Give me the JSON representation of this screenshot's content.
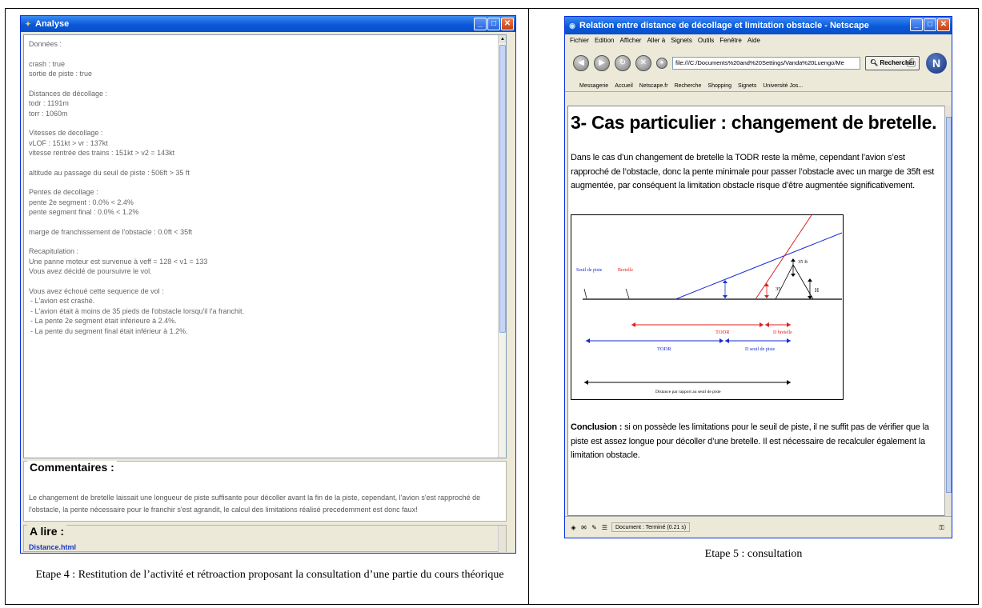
{
  "left_window": {
    "title": "Analyse",
    "body_lines": [
      {
        "text": "Données :",
        "gap_after": true
      },
      {
        "text": "crash : true"
      },
      {
        "text": "sortie de piste : true",
        "gap_after": true
      },
      {
        "text": "Distances de décollage :"
      },
      {
        "text": "todr : 1191m"
      },
      {
        "text": "torr : 1060m",
        "gap_after": true
      },
      {
        "text": "Vitesses de decollage :"
      },
      {
        "text": "vLOF : 151kt > vr : 137kt"
      },
      {
        "text": "vitesse rentrée des trains : 151kt > v2 = 143kt",
        "gap_after": true
      },
      {
        "text": "altitude au passage du seuil de piste : 506ft > 35 ft",
        "gap_after": true
      },
      {
        "text": "Pentes de decollage :"
      },
      {
        "text": "pente 2e segment : 0.0% < 2.4%"
      },
      {
        "text": "pente segment final : 0.0% < 1.2%",
        "gap_after": true
      },
      {
        "text": "marge de franchissement de l'obstacle : 0.0ft < 35ft",
        "gap_after": true
      },
      {
        "text": "Recapitulation :"
      },
      {
        "text": "Une panne moteur est survenue à veff = 128 < v1 = 133"
      },
      {
        "text": "Vous avez décidé de poursuivre le vol.",
        "gap_after": true
      },
      {
        "text": "Vous avez échoué cette sequence de vol :"
      },
      {
        "text": " - L'avion est crashé.",
        "indent": true
      },
      {
        "text": " - L'avion était à moins de 35 pieds de l'obstacle lorsqu'il l'a franchit.",
        "indent": true
      },
      {
        "text": " - La pente 2e segment était inférieure à 2.4%.",
        "indent": true
      },
      {
        "text": " - La pente du segment final était inférieur à 1.2%.",
        "indent": true
      }
    ],
    "comments_title": "Commentaires :",
    "comments_text": "Le changement de bretelle laissait une longueur de piste suffisante pour décoller avant la fin de la piste, cependant, l'avion s'est rapproché de l'obstacle, la pente nécessaire pour le franchir s'est agrandit, le calcul des limitations réalisé precedemment est donc faux!",
    "alire_title": "A lire :",
    "alire_link": "Distance.html"
  },
  "left_caption": "Etape 4 : Restitution de l’activité et rétroaction proposant la consultation d’une partie du cours théorique",
  "right_window": {
    "title": "Relation entre distance de décollage et limitation obstacle - Netscape",
    "menu": [
      "Fichier",
      "Edition",
      "Afficher",
      "Aller à",
      "Signets",
      "Outils",
      "Fenêtre",
      "Aide"
    ],
    "url": "file:///C:/Documents%20and%20Settings/Vanda%20Luengo/Me",
    "search_label": "Rechercher",
    "personal_bar": [
      "Messagerie",
      "Accueil",
      "Netscape.fr",
      "Recherche",
      "Shopping",
      "Signets",
      "Université Jos..."
    ],
    "heading": "3- Cas particulier : changement de bretelle.",
    "paragraph": "Dans le cas d’un changement de bretelle la TODR reste la même, cependant l’avion s’est rapproché de l’obstacle, donc la pente minimale pour passer l’obstacle avec un marge de 35ft est augmentée, par conséquent la limitation obstacle risque d’être augmentée significativement.",
    "diagram": {
      "seuil_label": "Seuil de piste",
      "bretelle_label": "Bretelle",
      "h35_label": "35 ft",
      "h35b_label": "35",
      "h_label": "H",
      "todr_red_label": "TODR",
      "d_bretelle_label": "D bretelle",
      "todr_blue_label": "TODR",
      "d_seuil_label": "D seuil de piste",
      "distance_label": "Distance par rapport au seuil de piste",
      "colors": {
        "red": "#e0201c",
        "blue": "#1a2bd0"
      }
    },
    "conclusion_bold": "Conclusion :",
    "conclusion_text": " si on possède les limitations pour le seuil de piste, il ne suffit pas de vérifier que la piste est assez longue pour décoller d’une bretelle. Il est nécessaire de recalculer également la limitation obstacle.",
    "status": "Document : Terminé (0.21 s)"
  },
  "right_caption": "Etape 5 : consultation"
}
